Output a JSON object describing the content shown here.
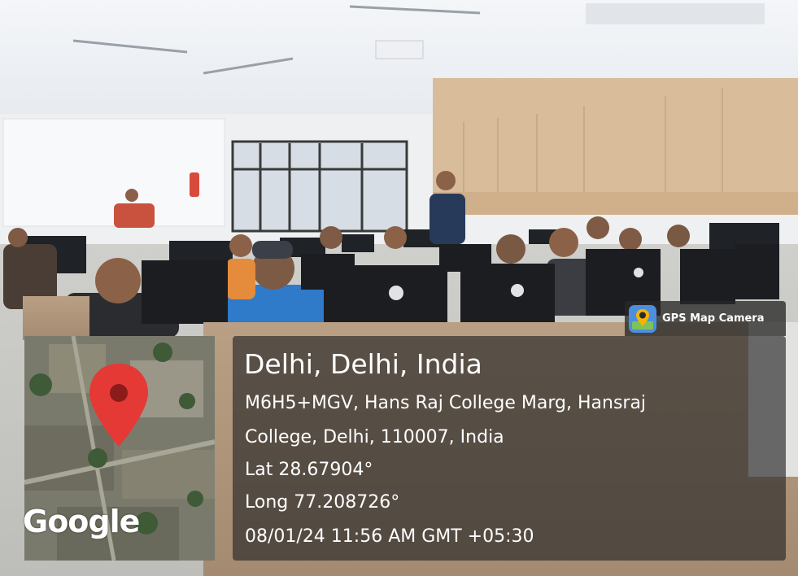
{
  "badge": {
    "app_name": "GPS Map Camera",
    "icon": "gps-map-camera-icon",
    "icon_bg": "#4c8fe0",
    "icon_pin": "#f4b400"
  },
  "map": {
    "provider_logo": "Google",
    "pin_icon": "map-pin-icon",
    "pin_color": "#e53935"
  },
  "location": {
    "title": "Delhi, Delhi, India",
    "address_line1": "M6H5+MGV, Hans Raj College Marg, Hansraj",
    "address_line2": "College, Delhi, 110007, India",
    "latitude": "Lat 28.67904°",
    "longitude": "Long 77.208726°",
    "timestamp": "08/01/24 11:56 AM GMT +05:30"
  },
  "colors": {
    "panel_bg": "#282828",
    "text": "#ffffff"
  }
}
